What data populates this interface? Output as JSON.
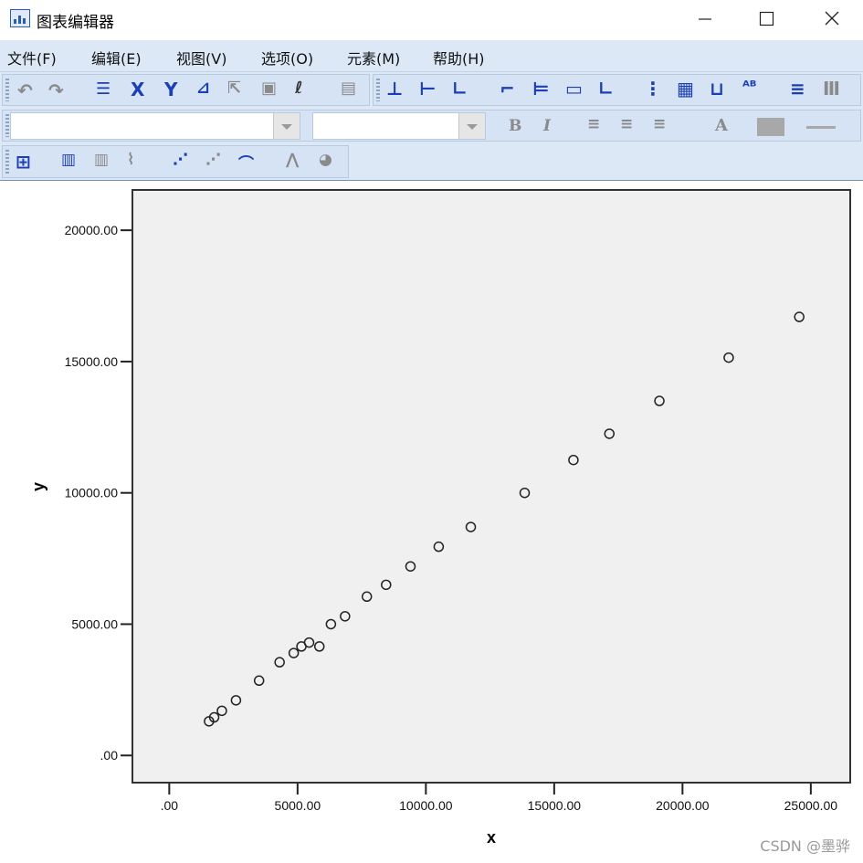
{
  "window": {
    "title": "图表编辑器",
    "minimize_icon": "minimize-icon",
    "maximize_icon": "maximize-icon",
    "close_icon": "close-icon"
  },
  "menu": {
    "items": [
      {
        "label": "文件(F)"
      },
      {
        "label": "编辑(E)"
      },
      {
        "label": "视图(V)"
      },
      {
        "label": "选项(O)"
      },
      {
        "label": "元素(M)"
      },
      {
        "label": "帮助(H)"
      }
    ]
  },
  "format_toolbar": {
    "bold_label": "B",
    "italic_label": "I",
    "text_color_label": "A"
  },
  "watermark": "CSDN @墨骅",
  "chart_data": {
    "type": "scatter",
    "xlabel": "x",
    "ylabel": "y",
    "xlim": [
      -1400,
      26500
    ],
    "ylim": [
      -1000,
      21500
    ],
    "xticks": [
      0,
      5000,
      10000,
      15000,
      20000,
      25000
    ],
    "xtick_labels": [
      ".00",
      "5000.00",
      "10000.00",
      "15000.00",
      "20000.00",
      "25000.00"
    ],
    "yticks": [
      0,
      5000,
      10000,
      15000,
      20000
    ],
    "ytick_labels": [
      ".00",
      "5000.00",
      "10000.00",
      "15000.00",
      "20000.00"
    ],
    "points": [
      {
        "x": 1550,
        "y": 1300
      },
      {
        "x": 1750,
        "y": 1450
      },
      {
        "x": 2050,
        "y": 1700
      },
      {
        "x": 2600,
        "y": 2100
      },
      {
        "x": 3500,
        "y": 2850
      },
      {
        "x": 4300,
        "y": 3550
      },
      {
        "x": 4850,
        "y": 3900
      },
      {
        "x": 5150,
        "y": 4150
      },
      {
        "x": 5450,
        "y": 4300
      },
      {
        "x": 5850,
        "y": 4150
      },
      {
        "x": 6300,
        "y": 5000
      },
      {
        "x": 6850,
        "y": 5300
      },
      {
        "x": 7700,
        "y": 6050
      },
      {
        "x": 8450,
        "y": 6500
      },
      {
        "x": 9400,
        "y": 7200
      },
      {
        "x": 10500,
        "y": 7950
      },
      {
        "x": 11750,
        "y": 8700
      },
      {
        "x": 13850,
        "y": 10000
      },
      {
        "x": 15750,
        "y": 11250
      },
      {
        "x": 17150,
        "y": 12250
      },
      {
        "x": 19100,
        "y": 13500
      },
      {
        "x": 21800,
        "y": 15150
      },
      {
        "x": 24550,
        "y": 16700
      }
    ],
    "marker": "open-circle",
    "plot_background": "#f0f0f0",
    "grid": false
  }
}
